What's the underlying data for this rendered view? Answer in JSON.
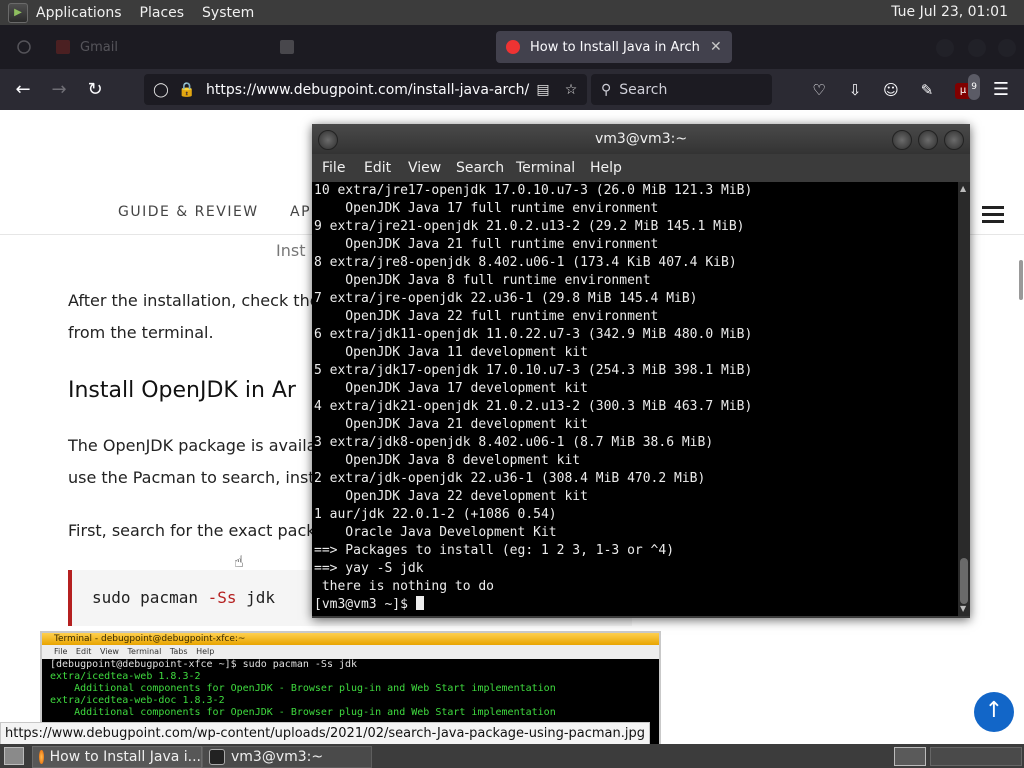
{
  "top_panel": {
    "menus": [
      "Applications",
      "Places",
      "System"
    ],
    "clock": "Tue Jul 23, 01:01"
  },
  "browser": {
    "tabs": [
      {
        "label": "Gmail",
        "active": false
      },
      {
        "label": "",
        "active": false
      },
      {
        "label": "How to Install Java in Arch L",
        "active": true
      }
    ],
    "url": "https://www.debugpoint.com/install-java-arch/",
    "search_placeholder": "Search",
    "extension_badge": "9",
    "status_url": "https://www.debugpoint.com/wp-content/uploads/2021/02/search-Java-package-using-pacman.jpg"
  },
  "webpage": {
    "nav": [
      "GUIDE & REVIEW",
      "AP"
    ],
    "fragment_inst": "Inst",
    "para1_line1": "After the installation, check the",
    "para1_line2": "from the terminal.",
    "heading": "Install OpenJDK in Ar",
    "para2_line1": "The OpenJDK package is availa",
    "para2_line2": "use the Pacman to search, inst",
    "para3": "First, search for the exact pack",
    "code_cmd": "sudo pacman ",
    "code_flag": "-Ss",
    "code_arg": " jdk",
    "embedded_image": {
      "title": "Terminal - debugpoint@debugpoint-xfce:~",
      "menu": "File  Edit  View  Terminal  Tabs  Help",
      "lines": [
        "[debugpoint@debugpoint-xfce ~]$ sudo pacman -Ss jdk",
        "extra/icedtea-web 1.8.3-2",
        "    Additional components for OpenJDK - Browser plug-in and Web Start implementation",
        "extra/icedtea-web-doc 1.8.3-2",
        "    Additional components for OpenJDK - Browser plug-in and Web Start implementation"
      ]
    }
  },
  "terminal": {
    "title": "vm3@vm3:~",
    "menu": [
      "File",
      "Edit",
      "View",
      "Search",
      "Terminal",
      "Help"
    ],
    "lines": [
      "10 extra/jre17-openjdk 17.0.10.u7-3 (26.0 MiB 121.3 MiB)",
      "    OpenJDK Java 17 full runtime environment",
      "9 extra/jre21-openjdk 21.0.2.u13-2 (29.2 MiB 145.1 MiB)",
      "    OpenJDK Java 21 full runtime environment",
      "8 extra/jre8-openjdk 8.402.u06-1 (173.4 KiB 407.4 KiB)",
      "    OpenJDK Java 8 full runtime environment",
      "7 extra/jre-openjdk 22.u36-1 (29.8 MiB 145.4 MiB)",
      "    OpenJDK Java 22 full runtime environment",
      "6 extra/jdk11-openjdk 11.0.22.u7-3 (342.9 MiB 480.0 MiB)",
      "    OpenJDK Java 11 development kit",
      "5 extra/jdk17-openjdk 17.0.10.u7-3 (254.3 MiB 398.1 MiB)",
      "    OpenJDK Java 17 development kit",
      "4 extra/jdk21-openjdk 21.0.2.u13-2 (300.3 MiB 463.7 MiB)",
      "    OpenJDK Java 21 development kit",
      "3 extra/jdk8-openjdk 8.402.u06-1 (8.7 MiB 38.6 MiB)",
      "    OpenJDK Java 8 development kit",
      "2 extra/jdk-openjdk 22.u36-1 (308.4 MiB 470.2 MiB)",
      "    OpenJDK Java 22 development kit",
      "1 aur/jdk 22.0.1-2 (+1086 0.54)",
      "    Oracle Java Development Kit",
      "==> Packages to install (eg: 1 2 3, 1-3 or ^4)",
      "==> yay -S jdk",
      " there is nothing to do"
    ],
    "prompt": "[vm3@vm3 ~]$ "
  },
  "taskbar": {
    "items": [
      "How to Install Java i...",
      "vm3@vm3:~"
    ]
  },
  "colors": {
    "panel": "#3c3c3c",
    "firefox_dark": "#2b2a33",
    "scroll_top": "#1266c8",
    "code_accent": "#b52020",
    "terminal_green": "#3fdb3f"
  }
}
